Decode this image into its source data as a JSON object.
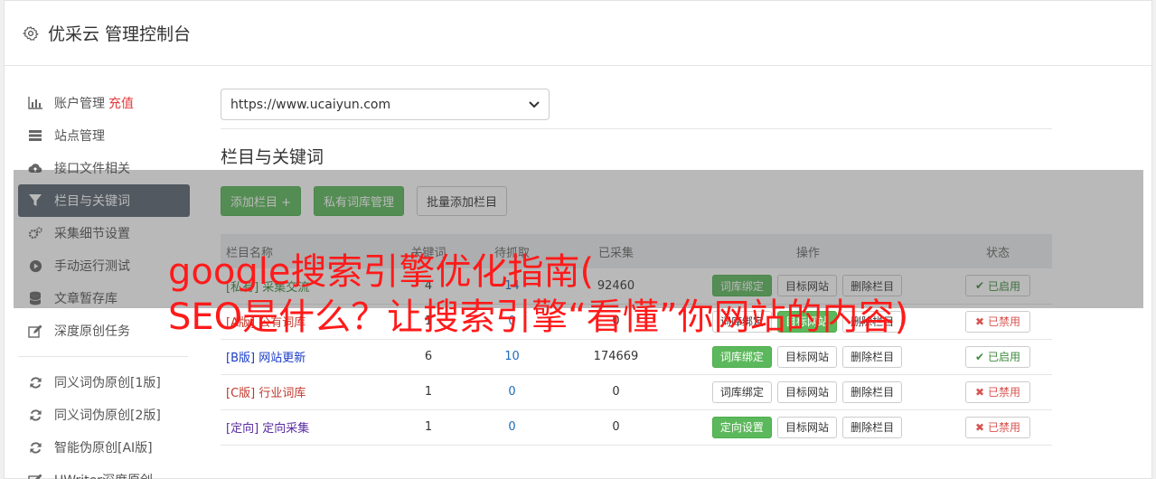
{
  "header": {
    "title": "优采云 管理控制台",
    "icon": "gear-icon"
  },
  "sidebar": {
    "items": [
      {
        "label": "账户管理",
        "extra": "充值",
        "icon": "bar-chart-icon"
      },
      {
        "label": "站点管理",
        "icon": "server-icon"
      },
      {
        "label": "接口文件相关",
        "icon": "cloud-upload-icon"
      },
      {
        "label": "栏目与关键词",
        "icon": "filter-icon",
        "active": true
      },
      {
        "label": "采集细节设置",
        "icon": "cogs-icon"
      },
      {
        "label": "手动运行测试",
        "icon": "play-circle-icon"
      },
      {
        "label": "文章暂存库",
        "icon": "database-icon"
      },
      {
        "label": "深度原创任务",
        "icon": "edit-icon"
      }
    ],
    "items2": [
      {
        "label": "同义词伪原创[1版]",
        "icon": "refresh-icon"
      },
      {
        "label": "同义词伪原创[2版]",
        "icon": "refresh-icon"
      },
      {
        "label": "智能伪原创[AI版]",
        "icon": "refresh-icon"
      },
      {
        "label": "UWriter深度原创",
        "icon": "edit-icon"
      }
    ]
  },
  "main": {
    "site_select": "https://www.ucaiyun.com",
    "section_title": "栏目与关键词",
    "buttons": {
      "add_column": "添加栏目 +",
      "private_lib": "私有词库管理",
      "batch_add": "批量添加栏目"
    },
    "table": {
      "headers": [
        "栏目名称",
        "关键词",
        "待抓取",
        "已采集",
        "操作",
        "状态"
      ],
      "rows": [
        {
          "prefix": "[私有]",
          "name": "采集交流",
          "kw": "4",
          "pending": "14",
          "collected": "92460",
          "bind": "词库绑定",
          "bind_green": true,
          "target": "目标网站",
          "del": "删除栏目",
          "status": "已启用",
          "on": true,
          "color": "green"
        },
        {
          "prefix": "[A版]",
          "name": "公有词库",
          "kw": "1",
          "pending": "0",
          "collected": "0",
          "bind": "词库绑定",
          "bind_green": false,
          "target": "目标网站",
          "del": "删除栏目",
          "status": "已禁用",
          "on": false,
          "color": "red"
        },
        {
          "prefix": "[B版]",
          "name": "网站更新",
          "kw": "6",
          "pending": "10",
          "collected": "174669",
          "bind": "词库绑定",
          "bind_green": true,
          "target": "目标网站",
          "del": "删除栏目",
          "status": "已启用",
          "on": true,
          "color": "blue"
        },
        {
          "prefix": "[C版]",
          "name": "行业词库",
          "kw": "1",
          "pending": "0",
          "collected": "0",
          "bind": "词库绑定",
          "bind_green": false,
          "target": "目标网站",
          "del": "删除栏目",
          "status": "已禁用",
          "on": false,
          "color": "red"
        },
        {
          "prefix": "[定向]",
          "name": "定向采集",
          "kw": "1",
          "pending": "0",
          "collected": "0",
          "bind": "定向设置",
          "bind_green": true,
          "target": "目标网站",
          "del": "删除栏目",
          "status": "已禁用",
          "on": false,
          "color": "purple"
        }
      ]
    }
  },
  "overlay": {
    "line1": "google搜索引擎优化指南(",
    "line2": "SEO是什么？让搜索引擎“看懂”你网站的内容)"
  },
  "colors": {
    "accent_green": "#5cb85c",
    "active_nav": "#5a6470",
    "overlay_text": "#ff1a1a",
    "recharge": "#e4393c"
  }
}
